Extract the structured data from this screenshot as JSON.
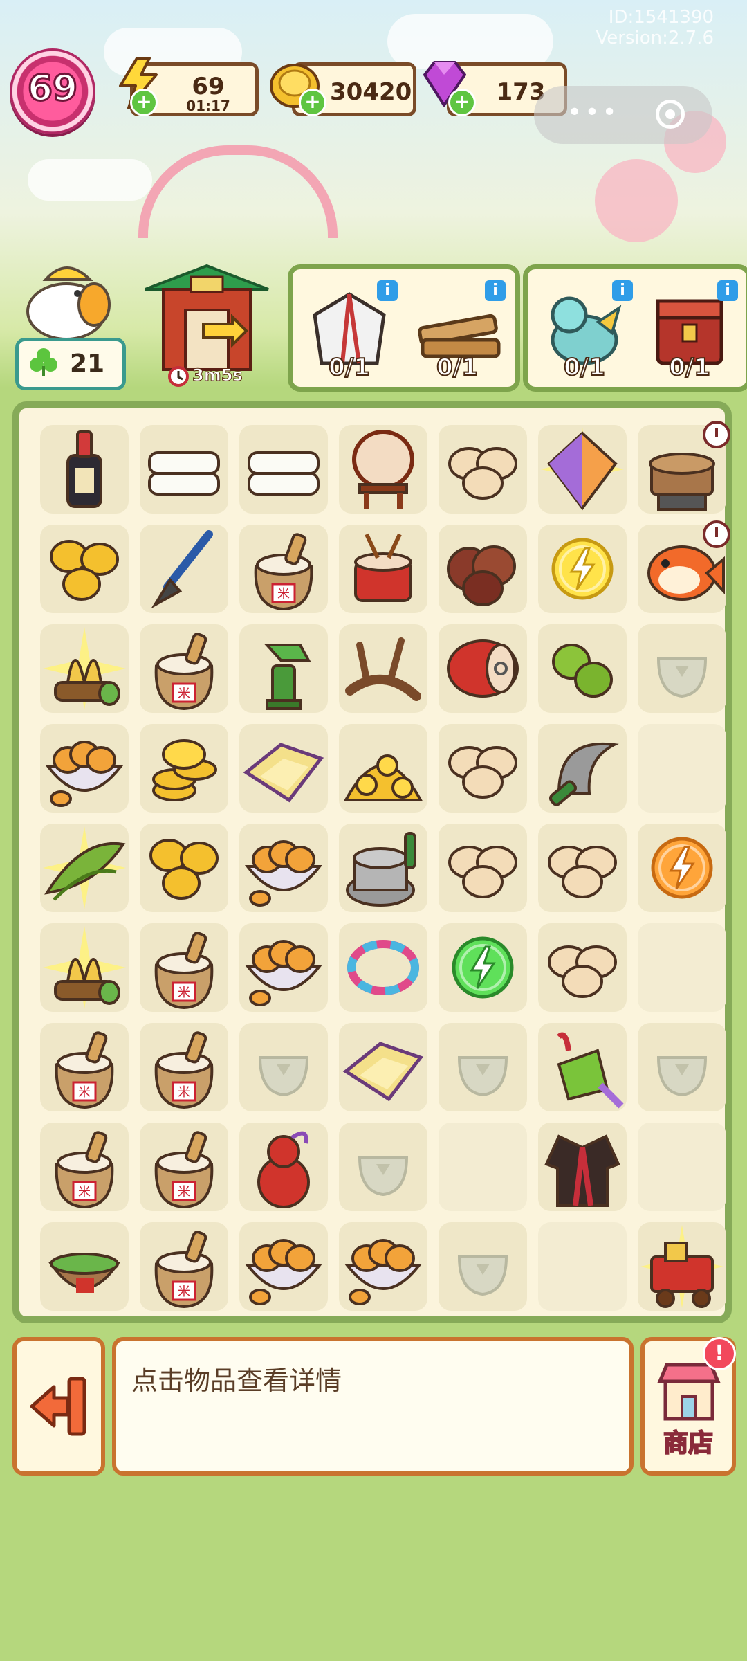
{
  "watermark": {
    "id": "ID:1541390",
    "version": "Version:2.7.6"
  },
  "player": {
    "level": "69"
  },
  "resources": {
    "energy": {
      "value": "69",
      "timer": "01:17"
    },
    "coins": {
      "value": "30420"
    },
    "gems": {
      "value": "173"
    }
  },
  "event": {
    "star_count": "21",
    "gate_timer": "3m5s"
  },
  "orders": [
    {
      "slots": [
        {
          "item": "folded-robe",
          "count": "0/1"
        },
        {
          "item": "wood-planks",
          "count": "0/1"
        }
      ]
    },
    {
      "slots": [
        {
          "item": "dragon-pet",
          "count": "0/1"
        },
        {
          "item": "red-chest",
          "count": "0/1"
        }
      ]
    }
  ],
  "board": {
    "rows": [
      [
        "ink-bottle",
        "cloth-stack",
        "cloth-stack",
        "big-drum",
        "dough-buns",
        "kite-sparkle",
        "steamer-timer"
      ],
      [
        "coin-pile",
        "brush",
        "rice-sack",
        "drum",
        "chestnuts",
        "energy-coin-yellow",
        "koi-timer"
      ],
      [
        "grain-sparkle",
        "rice-sack",
        "spout-pump",
        "wood-branch",
        "red-drum",
        "green-fruit",
        "locked"
      ],
      [
        "walnut-bowl",
        "coin-stack",
        "fabric-sheet",
        "coin-heap",
        "dough-buns",
        "sickle",
        "empty"
      ],
      [
        "leaves-sparkle",
        "coin-pile",
        "walnut-bowl",
        "stone-mill",
        "dough-buns",
        "dough-buns",
        "energy-coin-orange"
      ],
      [
        "grain-sparkle",
        "rice-sack",
        "walnut-bowl",
        "bead-bracelet",
        "energy-coin-green",
        "dough-buns",
        "empty"
      ],
      [
        "rice-sack",
        "rice-sack",
        "locked",
        "fabric-sheet",
        "locked",
        "zongzi-charm",
        "locked"
      ],
      [
        "rice-sack",
        "rice-sack",
        "red-gourd",
        "locked",
        "empty",
        "silk-robe",
        "empty"
      ],
      [
        "zongzi-basket",
        "rice-sack",
        "walnut-bowl",
        "walnut-bowl",
        "locked",
        "empty",
        "gift-cart-sparkle"
      ]
    ]
  },
  "bottom": {
    "hint": "点击物品查看详情",
    "shop_label": "商店",
    "shop_badge": "!"
  },
  "colors": {
    "board_border": "#86aa58",
    "panel_border": "#c9732f",
    "accent_pink": "#ff5c9d",
    "coin": "#f4c02e"
  }
}
